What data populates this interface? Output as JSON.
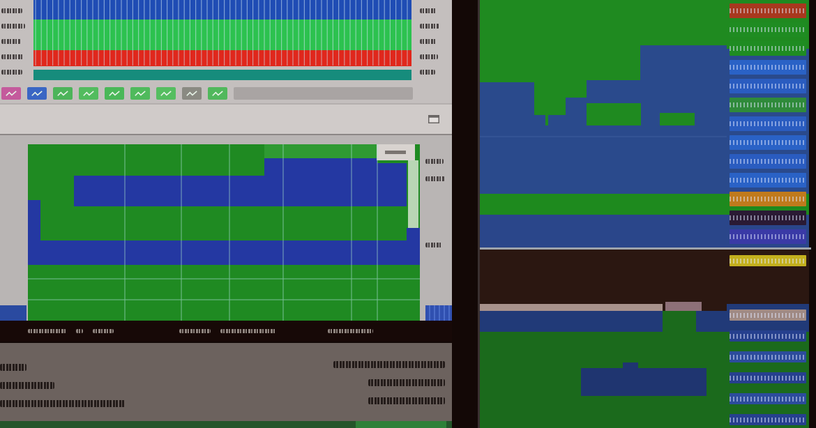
{
  "left_screen": {
    "panels": [
      {
        "kind": "stripes",
        "bands": [
          {
            "color": "#1f4cb4"
          },
          {
            "color": "#2cc24f"
          },
          {
            "color": "#e0271c"
          },
          {
            "color": "#168c7c"
          }
        ]
      },
      {
        "kind": "toolbar",
        "tools": [
          {
            "color": "#c45a9c"
          },
          {
            "color": "#3a66c4"
          },
          {
            "color": "#4cb45a"
          },
          {
            "color": "#52bc5e"
          },
          {
            "color": "#4ab858"
          },
          {
            "color": "#4fba5c"
          },
          {
            "color": "#55be60"
          },
          {
            "color": "#8a8a82"
          },
          {
            "color": "#50b85c"
          }
        ]
      },
      {
        "kind": "titlebar"
      },
      {
        "kind": "area"
      },
      {
        "kind": "status"
      },
      {
        "kind": "info"
      }
    ]
  },
  "right_screen": {
    "panels": [
      {
        "kind": "steps",
        "tags": [
          {
            "color": "#a8381e"
          },
          {
            "color": "#1f8c22"
          },
          {
            "color": "#1f8c22"
          },
          {
            "color": "#2a62c6"
          },
          {
            "color": "#2a5cc0"
          },
          {
            "color": "#2f8a3a"
          },
          {
            "color": "#2a5cc0"
          },
          {
            "color": "#2a62c6"
          },
          {
            "color": "#2a5cc0"
          },
          {
            "color": "#2a62c6"
          },
          {
            "color": "#c07a1c"
          },
          {
            "color": "#2a1a34"
          },
          {
            "color": "#3a3aa6"
          }
        ]
      },
      {
        "kind": "bands",
        "tags": [
          {
            "color": "#c4b01e"
          },
          {
            "color": "#a08a84"
          },
          {
            "color": "#26408e"
          },
          {
            "color": "#2c4c9c"
          },
          {
            "color": "#26408e"
          },
          {
            "color": "#2c4c9c"
          },
          {
            "color": "#26408e"
          }
        ]
      }
    ]
  }
}
